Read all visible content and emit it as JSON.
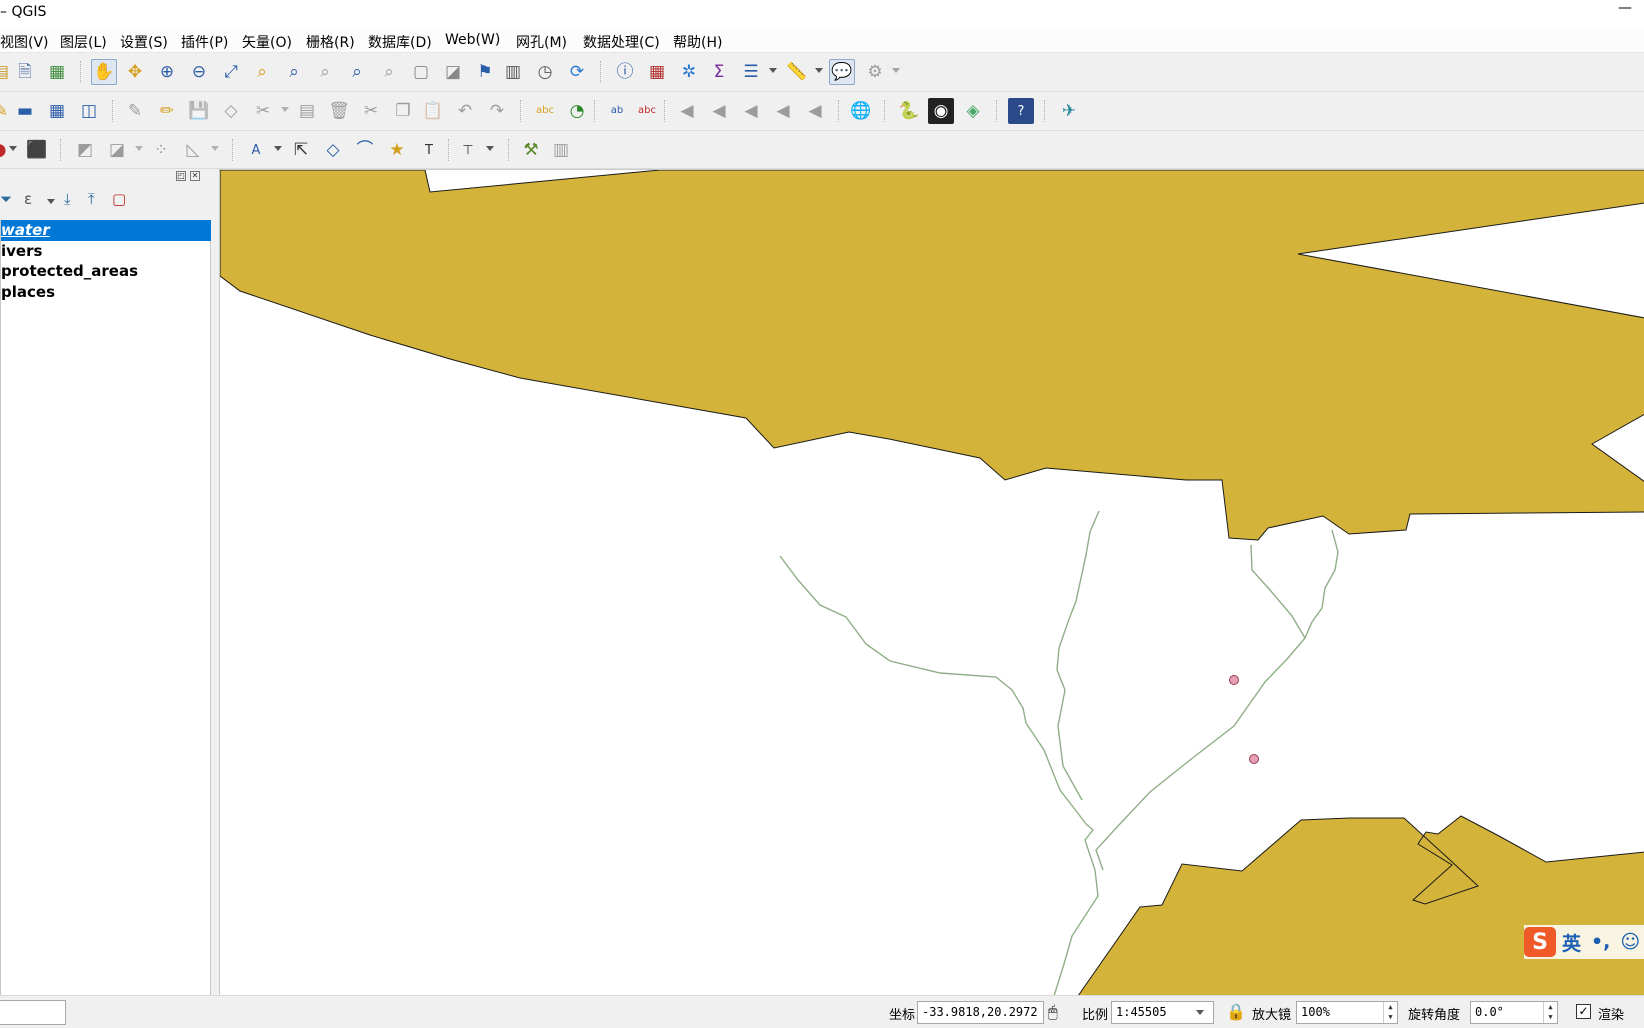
{
  "window": {
    "title": "– QGIS",
    "minimize": "—"
  },
  "menu": [
    {
      "label": "视图(V)"
    },
    {
      "label": "图层(L)"
    },
    {
      "label": "设置(S)"
    },
    {
      "label": "插件(P)"
    },
    {
      "label": "矢量(O)"
    },
    {
      "label": "栅格(R)"
    },
    {
      "label": "数据库(D)"
    },
    {
      "label": "Web(W)"
    },
    {
      "label": "网孔(M)"
    },
    {
      "label": "数据处理(C)"
    },
    {
      "label": "帮助(H)"
    }
  ],
  "layers_panel": {
    "layers": [
      {
        "name": "water",
        "selected": true
      },
      {
        "name": "ivers",
        "selected": false
      },
      {
        "name": "protected_areas",
        "selected": false
      },
      {
        "name": "places",
        "selected": false
      }
    ]
  },
  "map": {
    "polygon_fill": "#d4b33b",
    "river_color": "#8fae88",
    "point_color": "#e3a0b0"
  },
  "ime": {
    "mode": "英",
    "punct": "•,",
    "emoji": "☺",
    "logo": "S"
  },
  "status": {
    "coord_label": "坐标",
    "coord_value": "-33.9818,20.2972",
    "scale_label": "比例",
    "scale_value": "1:45505",
    "magnifier_label": "放大镜",
    "magnifier_value": "100%",
    "rotation_label": "旋转角度",
    "rotation_value": "0.0°",
    "render_label": "渲染",
    "render_checked": "✓"
  }
}
